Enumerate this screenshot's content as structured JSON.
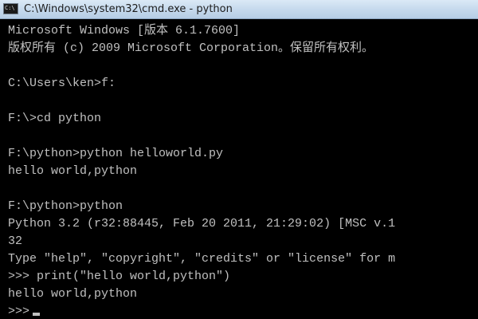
{
  "window": {
    "title": "C:\\Windows\\system32\\cmd.exe - python",
    "icon": "C:\\"
  },
  "console": {
    "lines": [
      "Microsoft Windows [版本 6.1.7600]",
      "版权所有 (c) 2009 Microsoft Corporation。保留所有权利。",
      "",
      "C:\\Users\\ken>f:",
      "",
      "F:\\>cd python",
      "",
      "F:\\python>python helloworld.py",
      "hello world,python",
      "",
      "F:\\python>python",
      "Python 3.2 (r32:88445, Feb 20 2011, 21:29:02) [MSC v.1",
      "32",
      "Type \"help\", \"copyright\", \"credits\" or \"license\" for m",
      ">>> print(\"hello world,python\")",
      "hello world,python",
      ">>>"
    ]
  }
}
